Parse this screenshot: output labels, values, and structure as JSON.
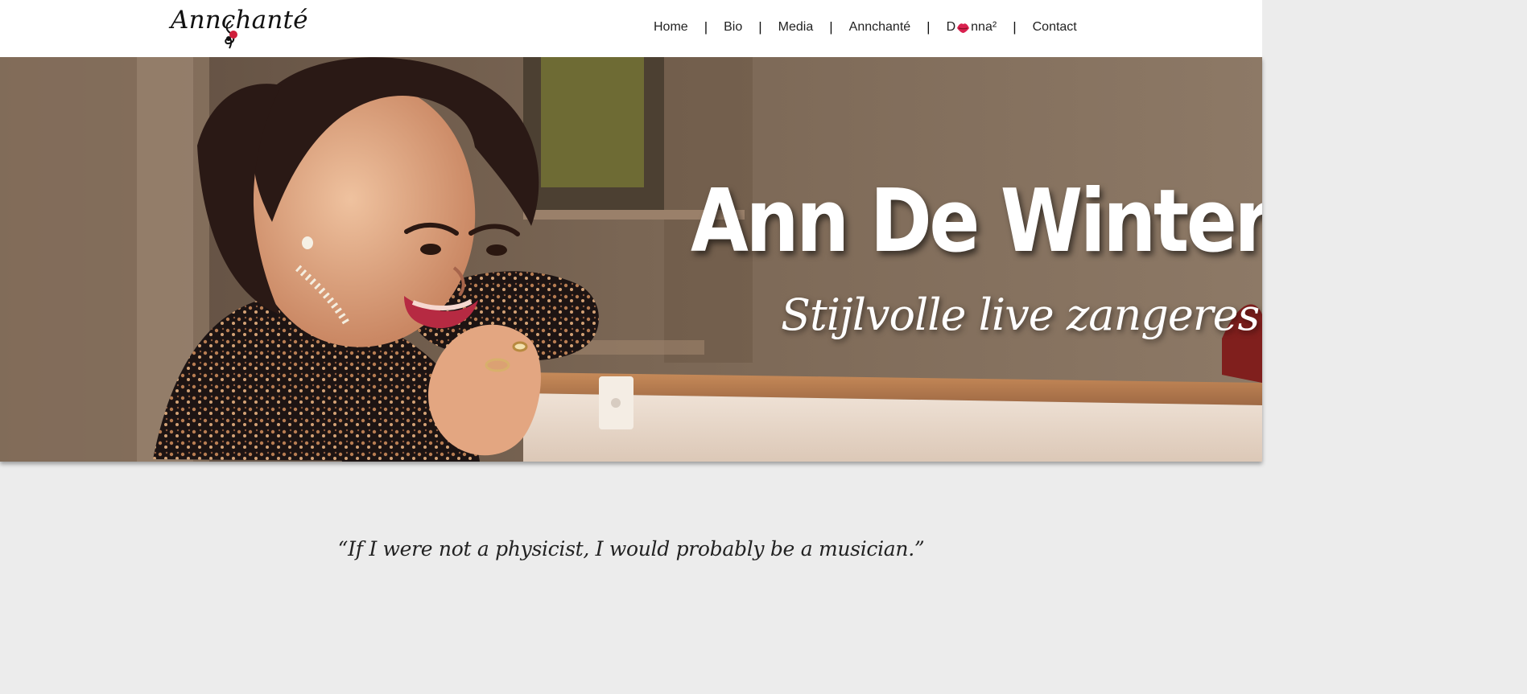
{
  "header": {
    "logo_text": "Annchanté",
    "nav": [
      {
        "label": "Home"
      },
      {
        "label": "Bio"
      },
      {
        "label": "Media"
      },
      {
        "label": "Annchanté"
      },
      {
        "prefix": "D",
        "suffix": "nna²"
      },
      {
        "label": "Contact"
      }
    ],
    "separator": "|"
  },
  "hero": {
    "title": "Ann De Winter",
    "subtitle": "Stijlvolle live zangeres"
  },
  "quote": {
    "text": "“If I were not a physicist, I would probably be a musician.”"
  },
  "colors": {
    "header_bg": "#ffffff",
    "page_bg": "#ececec",
    "title_text": "#ffffff",
    "lips_red": "#d9214f"
  },
  "icons": {
    "lips": "lips-icon",
    "clef": "music-clef-icon"
  }
}
